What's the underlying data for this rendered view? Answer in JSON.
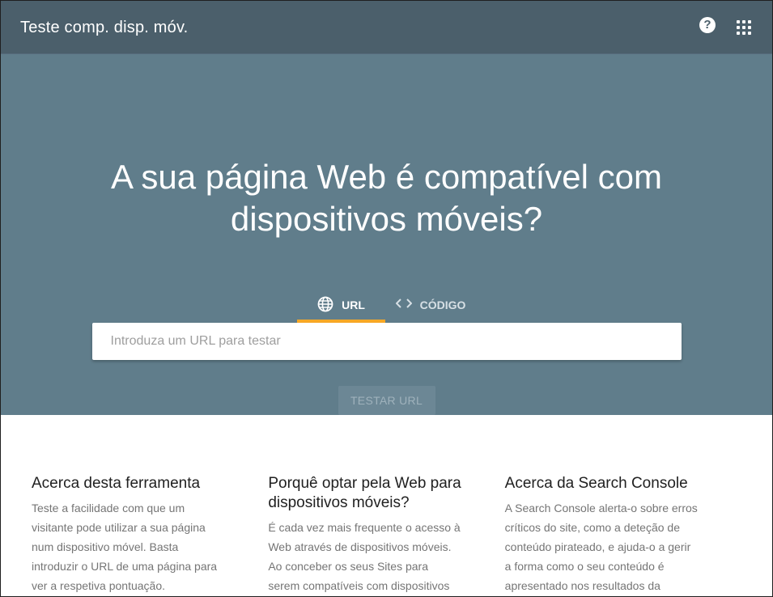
{
  "header": {
    "title": "Teste comp. disp. móv.",
    "help_icon": "help-circle-icon",
    "apps_icon": "apps-grid-icon"
  },
  "hero": {
    "title": "A sua página Web é compatível com dispositivos móveis?",
    "tabs": [
      {
        "label": "URL",
        "icon": "globe-icon",
        "active": true
      },
      {
        "label": "CÓDIGO",
        "icon": "code-brackets-icon",
        "active": false
      }
    ],
    "input": {
      "placeholder": "Introduza um URL para testar",
      "value": ""
    },
    "submit_label": "TESTAR URL"
  },
  "info": [
    {
      "title": "Acerca desta ferramenta",
      "text": "Teste a facilidade com que um visitante pode utilizar a sua página num dispositivo móvel. Basta introduzir o URL de uma página para ver a respetiva pontuação."
    },
    {
      "title": "Porquê optar pela Web para dispositivos móveis?",
      "text": "É cada vez mais frequente o acesso à Web através de dispositivos móveis. Ao conceber os seus Sites para serem compatíveis com dispositivos móveis,"
    },
    {
      "title": "Acerca da Search Console",
      "text": "A Search Console alerta-o sobre erros críticos do site, como a deteção de conteúdo pirateado, e ajuda-o a gerir a forma como o seu conteúdo é apresentado nos resultados da"
    }
  ],
  "colors": {
    "header_bg": "#4b5f6b",
    "hero_bg": "#607d8b",
    "tab_indicator": "#f9a825"
  }
}
